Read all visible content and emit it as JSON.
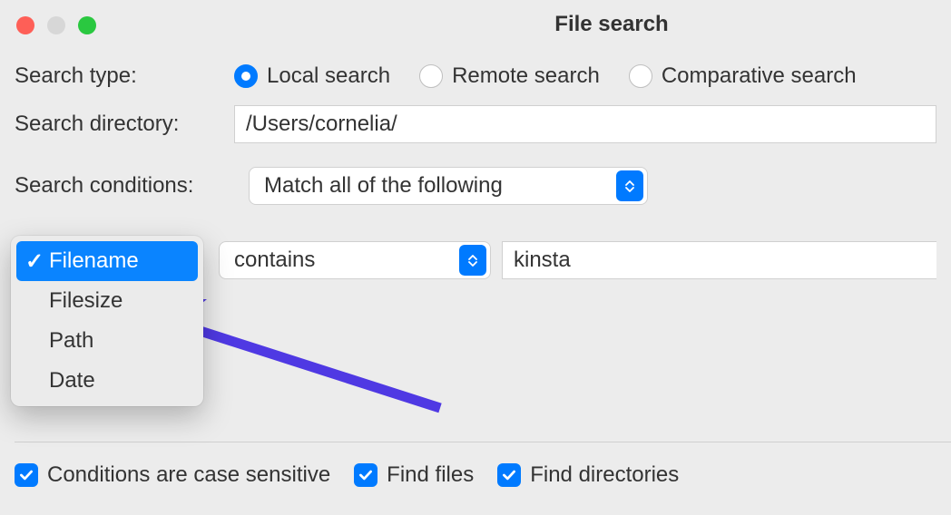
{
  "window": {
    "title": "File search"
  },
  "search_type": {
    "label": "Search type:",
    "options": {
      "local": "Local search",
      "remote": "Remote search",
      "comparative": "Comparative search"
    },
    "selected": "local"
  },
  "search_directory": {
    "label": "Search directory:",
    "value": "/Users/cornelia/"
  },
  "search_conditions": {
    "label": "Search conditions:",
    "match_label": "Match all of the following"
  },
  "condition": {
    "field_selected": "Filename",
    "field_options": [
      "Filename",
      "Filesize",
      "Path",
      "Date"
    ],
    "operator": "contains",
    "value": "kinsta"
  },
  "footer": {
    "case_sensitive": "Conditions are case sensitive",
    "find_files": "Find files",
    "find_directories": "Find directories"
  }
}
